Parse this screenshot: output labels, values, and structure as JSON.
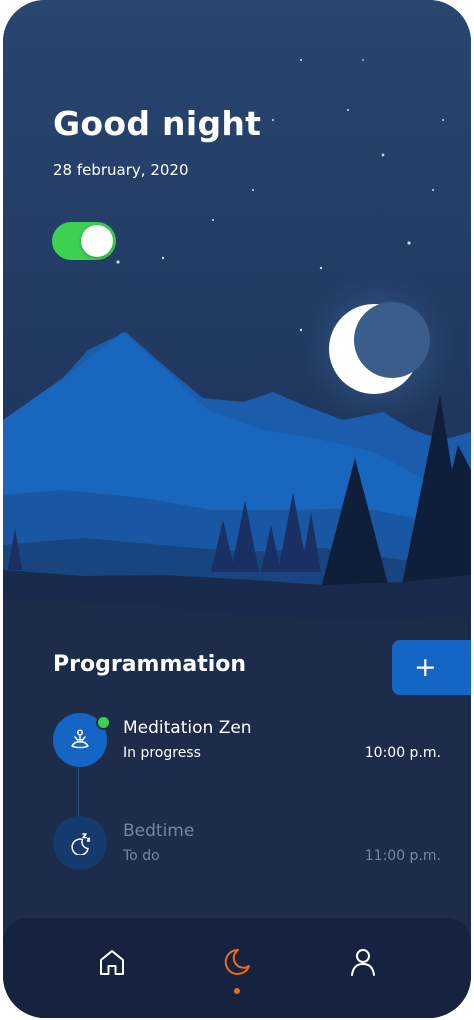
{
  "header": {
    "greeting": "Good night",
    "date": "28 february, 2020"
  },
  "night_mode_toggle": {
    "on": true
  },
  "programmation": {
    "title": "Programmation",
    "add_label": "+",
    "items": [
      {
        "title": "Meditation Zen",
        "status": "In progress",
        "time": "10:00 p.m.",
        "icon": "meditation-icon",
        "active": true
      },
      {
        "title": "Bedtime",
        "status": "To do",
        "time": "11:00 p.m.",
        "icon": "sleeping-moon-icon",
        "active": false
      }
    ]
  },
  "bottom_nav": {
    "items": [
      {
        "icon": "home-icon",
        "active": false
      },
      {
        "icon": "moon-icon",
        "active": true
      },
      {
        "icon": "profile-icon",
        "active": false
      }
    ]
  },
  "colors": {
    "background": "#1d2c4b",
    "accent_blue": "#1565c4",
    "toggle_green": "#3ed051",
    "active_nav_orange": "#f06a1a",
    "muted_text": "#7886a0"
  }
}
